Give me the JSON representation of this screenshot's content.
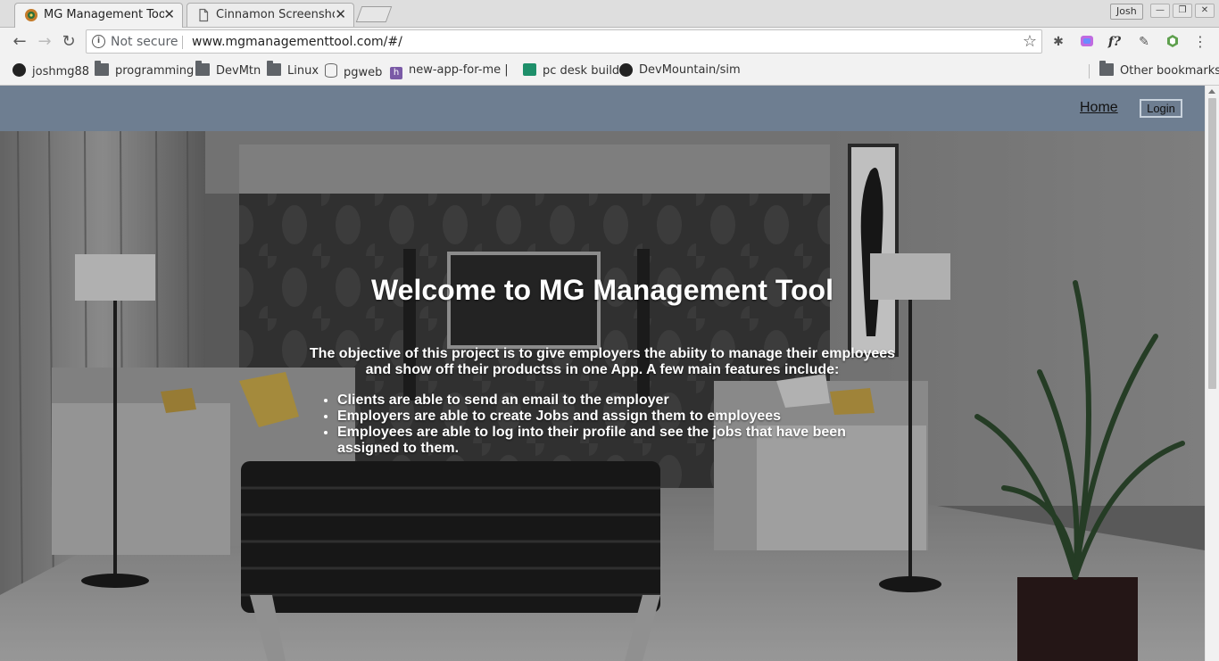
{
  "browser": {
    "tabs": [
      {
        "title": "MG Management Tool",
        "active": true
      },
      {
        "title": "Cinnamon Screenshot S",
        "active": false
      }
    ],
    "profile_name": "Josh",
    "not_secure_label": "Not secure",
    "url": "www.mgmanagementtool.com/#/",
    "ext_formula_label": "f?",
    "bookmarks": [
      {
        "label": "joshmg88",
        "icon": "github-icon"
      },
      {
        "label": "programming",
        "icon": "folder-icon"
      },
      {
        "label": "DevMtn",
        "icon": "folder-icon"
      },
      {
        "label": "Linux",
        "icon": "folder-icon"
      },
      {
        "label": "pgweb",
        "icon": "database-icon"
      },
      {
        "label": "new-app-for-me | H",
        "icon": "heroku-icon"
      },
      {
        "label": "pc desk build",
        "icon": "pcpartpicker-icon"
      },
      {
        "label": "DevMountain/simula",
        "icon": "github-icon"
      }
    ],
    "other_bookmarks": "Other bookmarks"
  },
  "nav": {
    "home": "Home",
    "login": "Login"
  },
  "hero": {
    "title": "Welcome to MG Management Tool",
    "intro": "The objective of this project is to give employers the abiity to manage their employees and show off their productss in one App. A few main features include:",
    "features": [
      "Clients are able to send an email to the employer",
      "Employers are able to create Jobs and assign them to employees",
      "Employees are able to log into their profile and see the jobs that have been assigned to them."
    ]
  },
  "colors": {
    "nav_bar": "#6e7e91",
    "hero_text": "#ffffff"
  }
}
